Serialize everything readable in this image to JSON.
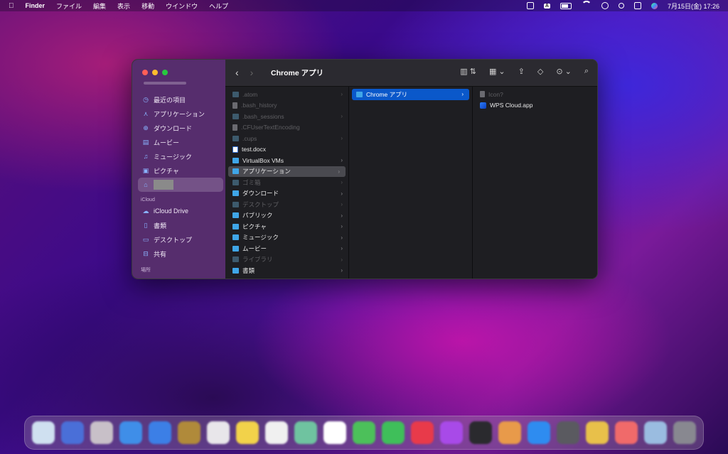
{
  "menubar": {
    "apple": "",
    "app": "Finder",
    "items": [
      "ファイル",
      "編集",
      "表示",
      "移動",
      "ウインドウ",
      "ヘルプ"
    ],
    "input_indicator": "A",
    "datetime": "7月15日(金) 17:26"
  },
  "window": {
    "title": "Chrome アプリ",
    "sidebar": {
      "favorites": [
        {
          "label": "最近の項目",
          "icon": "clock-icon"
        },
        {
          "label": "アプリケーション",
          "icon": "apps-icon"
        },
        {
          "label": "ダウンロード",
          "icon": "download-icon"
        },
        {
          "label": "ムービー",
          "icon": "film-icon"
        },
        {
          "label": "ミュージック",
          "icon": "music-icon"
        },
        {
          "label": "ピクチャ",
          "icon": "photo-icon"
        }
      ],
      "icloud_header": "iCloud",
      "icloud": [
        {
          "label": "iCloud Drive",
          "icon": "cloud-icon"
        },
        {
          "label": "書類",
          "icon": "document-icon"
        },
        {
          "label": "デスクトップ",
          "icon": "desktop-icon"
        },
        {
          "label": "共有",
          "icon": "shared-folder-icon"
        }
      ],
      "locations_header": "場所"
    },
    "column1": [
      {
        "name": ".atom",
        "kind": "folder",
        "dim": true,
        "chevron": true
      },
      {
        "name": ".bash_history",
        "kind": "file",
        "dim": true,
        "chevron": false
      },
      {
        "name": ".bash_sessions",
        "kind": "folder",
        "dim": true,
        "chevron": true
      },
      {
        "name": ".CFUserTextEncoding",
        "kind": "file",
        "dim": true,
        "chevron": false
      },
      {
        "name": ".cups",
        "kind": "folder",
        "dim": true,
        "chevron": true
      },
      {
        "name": "test.docx",
        "kind": "doc",
        "dim": false,
        "chevron": false
      },
      {
        "name": "VirtualBox VMs",
        "kind": "folder",
        "dim": false,
        "chevron": true
      },
      {
        "name": "アプリケーション",
        "kind": "folder",
        "dim": false,
        "chevron": true,
        "selected": true
      },
      {
        "name": "ゴミ箱",
        "kind": "folder",
        "dim": true,
        "chevron": true
      },
      {
        "name": "ダウンロード",
        "kind": "folder",
        "dim": false,
        "chevron": true
      },
      {
        "name": "デスクトップ",
        "kind": "folder",
        "dim": true,
        "chevron": true
      },
      {
        "name": "パブリック",
        "kind": "folder",
        "dim": false,
        "chevron": true
      },
      {
        "name": "ピクチャ",
        "kind": "folder",
        "dim": false,
        "chevron": true
      },
      {
        "name": "ミュージック",
        "kind": "folder",
        "dim": false,
        "chevron": true
      },
      {
        "name": "ムービー",
        "kind": "folder",
        "dim": false,
        "chevron": true
      },
      {
        "name": "ライブラリ",
        "kind": "folder",
        "dim": true,
        "chevron": true
      },
      {
        "name": "書類",
        "kind": "folder",
        "dim": false,
        "chevron": true
      }
    ],
    "column2": [
      {
        "name": "Chrome アプリ",
        "kind": "folder",
        "chevron": true,
        "selected": true
      }
    ],
    "column3": [
      {
        "name": "Icon?",
        "kind": "file",
        "dim": true
      },
      {
        "name": "WPS Cloud.app",
        "kind": "app",
        "dim": false
      }
    ]
  },
  "dock": {
    "colors": [
      "#cfe0f0",
      "#4a6fd8",
      "#c8c0c8",
      "#3f8ee8",
      "#3c7fe6",
      "#b08a3a",
      "#e8e6ea",
      "#f2d24a",
      "#f0f0f0",
      "#6fc3a0",
      "#ffffff",
      "#4cc05a",
      "#3fbf5a",
      "#e83a4a",
      "#a84ae8",
      "#2a2a2e",
      "#e89a4a",
      "#2e8cf0",
      "#5a5a60",
      "#e8c04a",
      "#f06a6a",
      "#9abce0",
      "#888890"
    ]
  }
}
